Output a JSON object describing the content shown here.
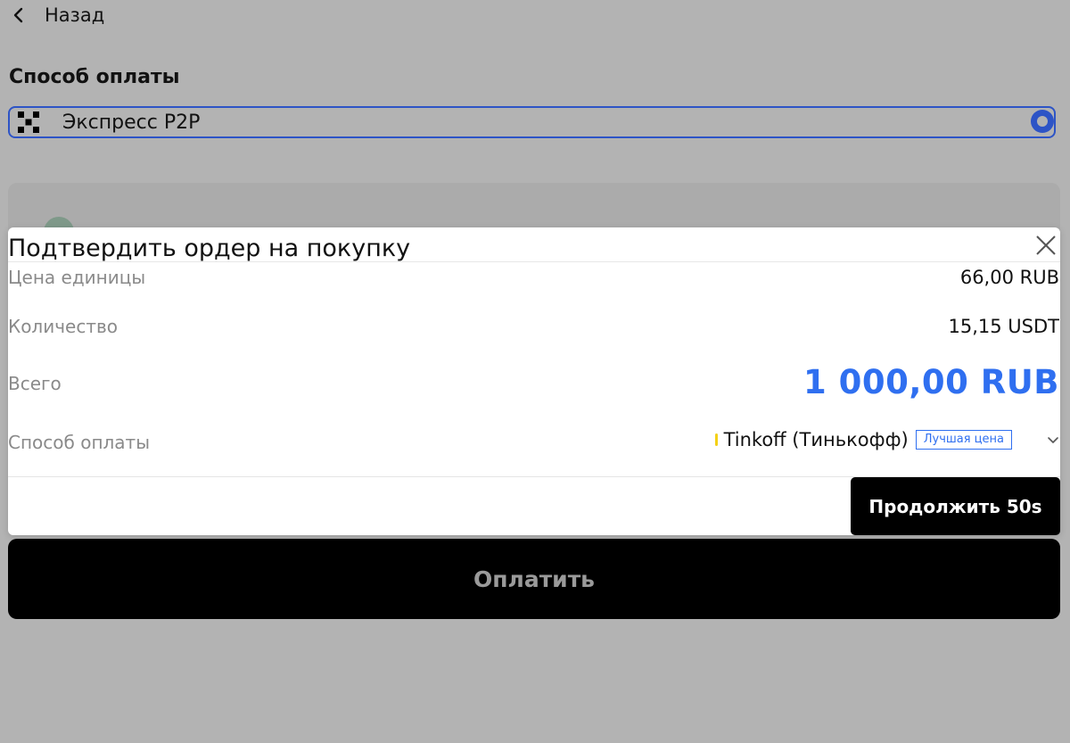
{
  "nav": {
    "back_label": "Назад"
  },
  "section": {
    "title": "Способ оплаты"
  },
  "selected_option": {
    "label": "Экспресс P2P",
    "logo_icon": "okx-logo-icon",
    "radio_color": "#2d54c6"
  },
  "background_option": {
    "icon": "usdt-icon"
  },
  "pay_button": {
    "label": "Оплатить"
  },
  "dialog": {
    "title": "Подтвердить ордер на покупку",
    "close_icon": "close-icon",
    "rows": {
      "unit_price": {
        "label": "Цена единицы",
        "value": "66,00 RUB"
      },
      "quantity": {
        "label": "Количество",
        "value": "15,15 USDT"
      },
      "total": {
        "label": "Всего",
        "value": "1 000,00 RUB"
      },
      "payment_method": {
        "label": "Способ оплаты",
        "bank": "Tinkoff (Тинькофф)",
        "badge": "Лучшая цена",
        "bank_marker_color": "#f4d117"
      }
    },
    "continue_label": "Продолжить 50s",
    "accent_color": "#2f6ff0"
  }
}
